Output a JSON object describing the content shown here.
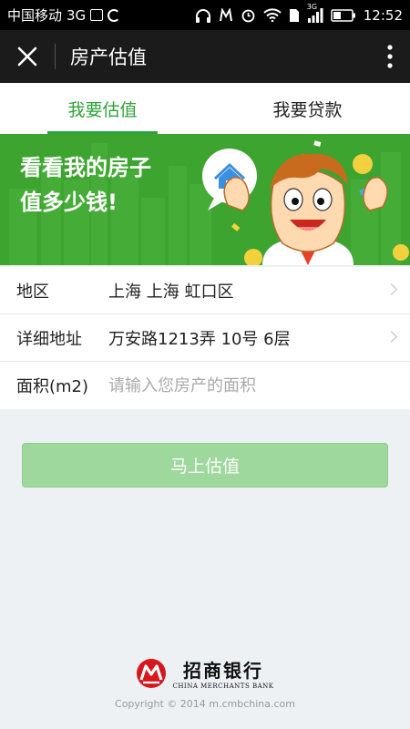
{
  "status_bar": {
    "carrier": "中国移动",
    "network": "3G",
    "network_small": "3G",
    "time": "12:52"
  },
  "title_bar": {
    "title": "房产估值",
    "close_icon": "close-icon",
    "more_icon": "more-vertical-icon"
  },
  "tabs": [
    {
      "label": "我要估值",
      "active": true
    },
    {
      "label": "我要贷款",
      "active": false
    }
  ],
  "banner": {
    "line1": "看看我的房子",
    "line2": "值多少钱!"
  },
  "form": {
    "region": {
      "label": "地区",
      "value": "上海 上海 虹口区"
    },
    "address": {
      "label": "详细地址",
      "value": "万安路1213弄 10号 6层"
    },
    "area": {
      "label": "面积(m2)",
      "placeholder": "请输入您房产的面积",
      "value": ""
    }
  },
  "submit": {
    "label": "马上估值"
  },
  "footer": {
    "brand_cn": "招商银行",
    "brand_en": "CHINA MERCHANTS BANK",
    "copyright": "Copyright © 2014 m.cmbchina.com"
  },
  "colors": {
    "accent": "#2ea33a",
    "banner": "#3ca42f",
    "button": "#9ed89d",
    "brand_red": "#d7161e"
  }
}
